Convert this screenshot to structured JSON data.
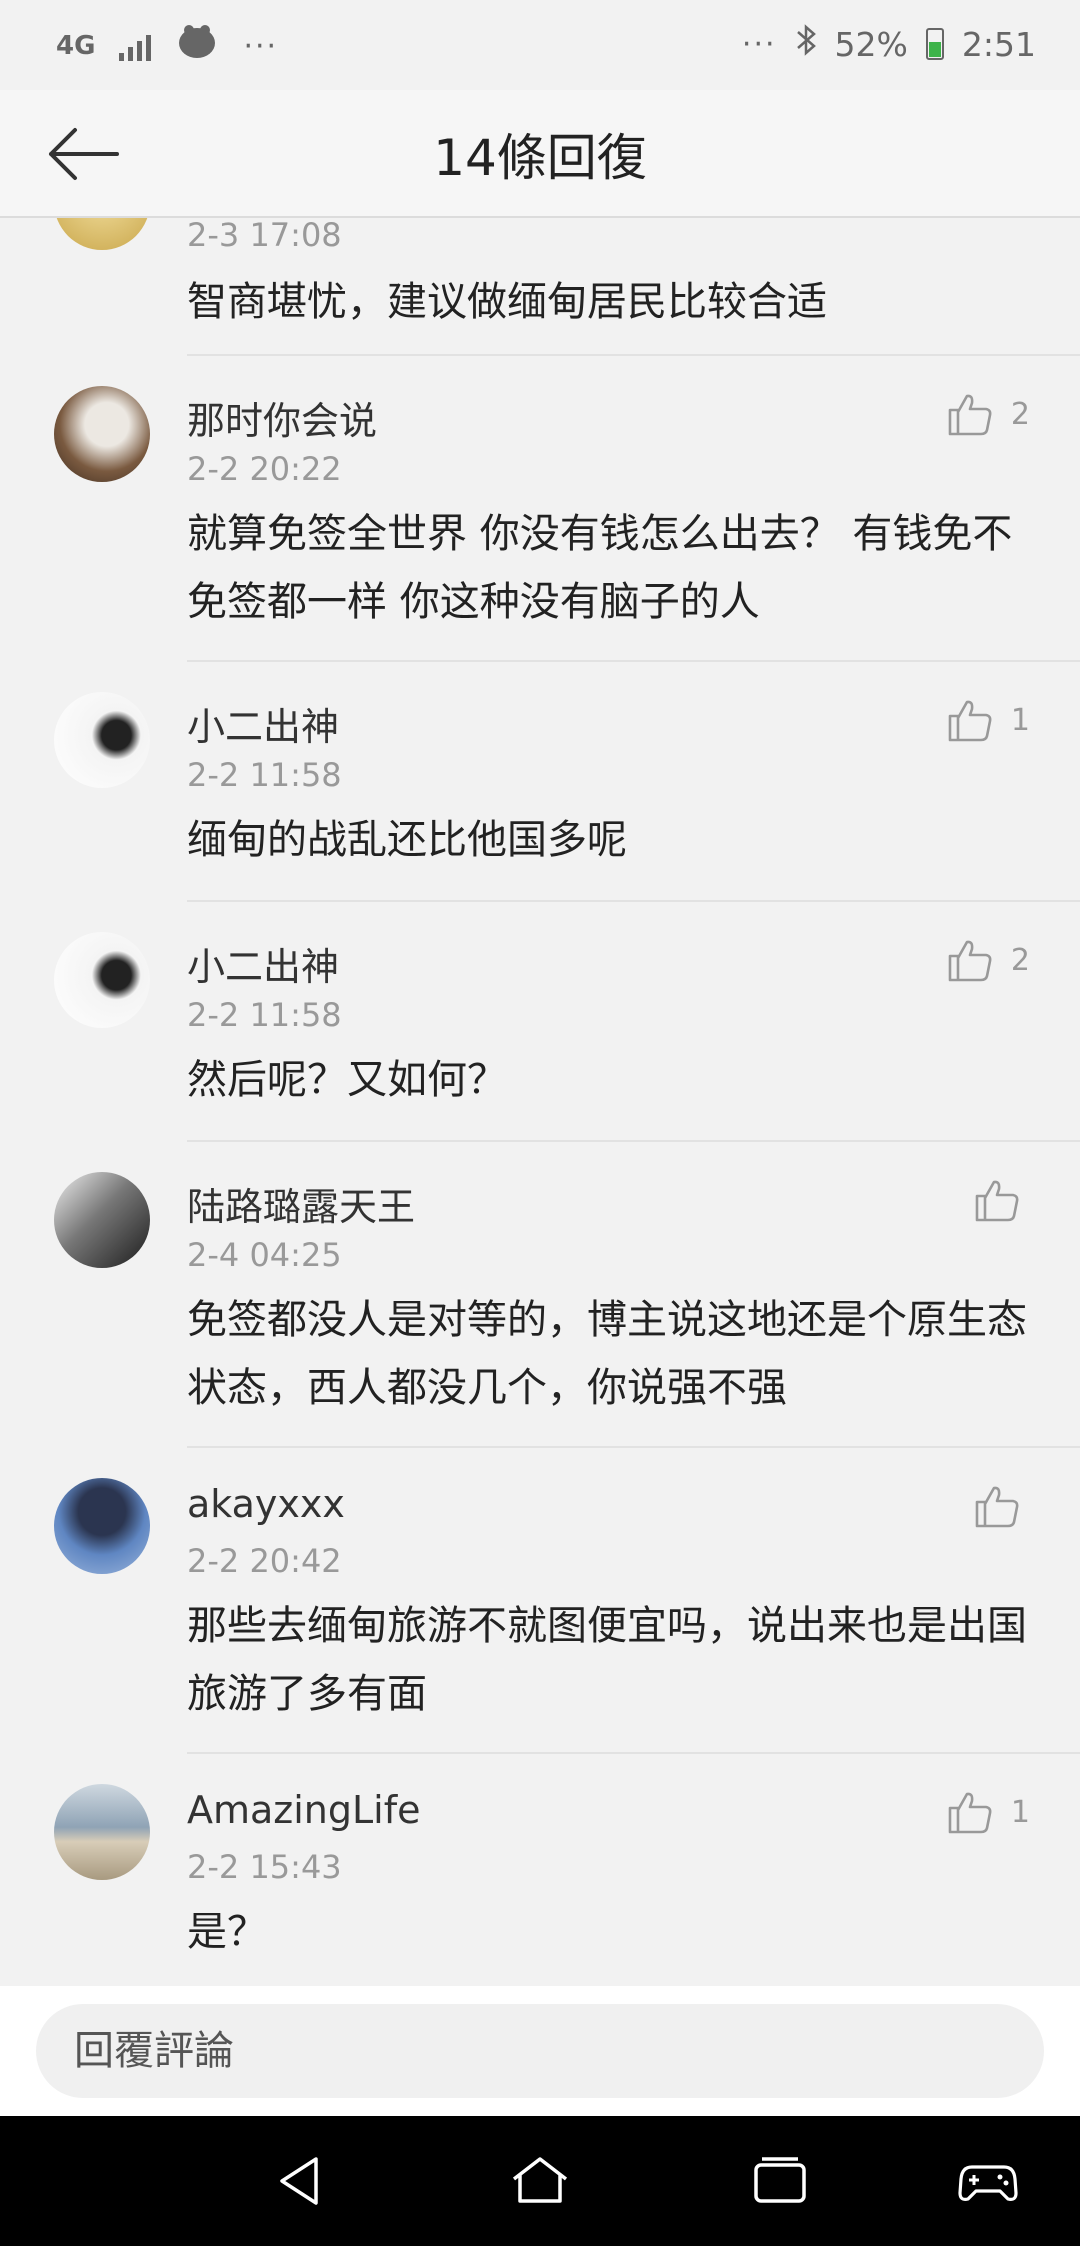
{
  "status_bar": {
    "network": "4G",
    "more": "···",
    "more_right": "···",
    "battery": "52%",
    "time": "2:51"
  },
  "header": {
    "title": "14條回復"
  },
  "comments": [
    {
      "name": "",
      "time": "2-3 17:08",
      "text": "智商堪忧，建议做缅甸居民比较合适",
      "likes": ""
    },
    {
      "name": "那时你会说",
      "time": "2-2 20:22",
      "text": "就算免签全世界 你没有钱怎么出去？ 有钱免不免签都一样 你这种没有脑子的人",
      "likes": "2"
    },
    {
      "name": "小二出神",
      "time": "2-2 11:58",
      "text": "缅甸的战乱还比他国多呢",
      "likes": "1"
    },
    {
      "name": "小二出神",
      "time": "2-2 11:58",
      "text": "然后呢？又如何？",
      "likes": "2"
    },
    {
      "name": "陆路璐露天王",
      "time": "2-4 04:25",
      "text": "免签都没人是对等的，博主说这地还是个原生态状态，西人都没几个，你说强不强",
      "likes": ""
    },
    {
      "name": "akayxxx",
      "time": "2-2 20:42",
      "text": "那些去缅甸旅游不就图便宜吗，说出来也是出国旅游了多有面",
      "likes": ""
    },
    {
      "name": "AmazingLife",
      "time": "2-2 15:43",
      "text": "是？",
      "likes": "1"
    }
  ],
  "reply": {
    "placeholder": "回覆評論"
  },
  "colors": {
    "background": "#f2f2f2",
    "text_primary": "#222222",
    "text_secondary": "#999999",
    "divider": "#e2e2e2",
    "navbar": "#000000"
  }
}
